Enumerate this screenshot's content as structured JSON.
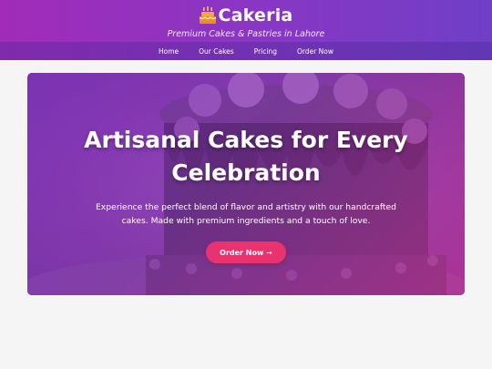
{
  "header": {
    "brand_icon": "birthday-cake-icon",
    "brand_name": "Cakeria",
    "tagline": "Premium Cakes & Pastries in Lahore",
    "colors": {
      "gradient_start": "#a02cb8",
      "gradient_end": "#6f3fc6"
    }
  },
  "nav": {
    "items": [
      {
        "label": "Home"
      },
      {
        "label": "Our Cakes"
      },
      {
        "label": "Pricing"
      },
      {
        "label": "Order Now"
      }
    ]
  },
  "hero": {
    "title": "Artisanal Cakes for Every Celebration",
    "text": "Experience the perfect blend of flavor and artistry with our handcrafted cakes. Made with premium ingredients and a touch of love.",
    "cta_label": "Order Now →",
    "cta_color": "#e8336e"
  }
}
